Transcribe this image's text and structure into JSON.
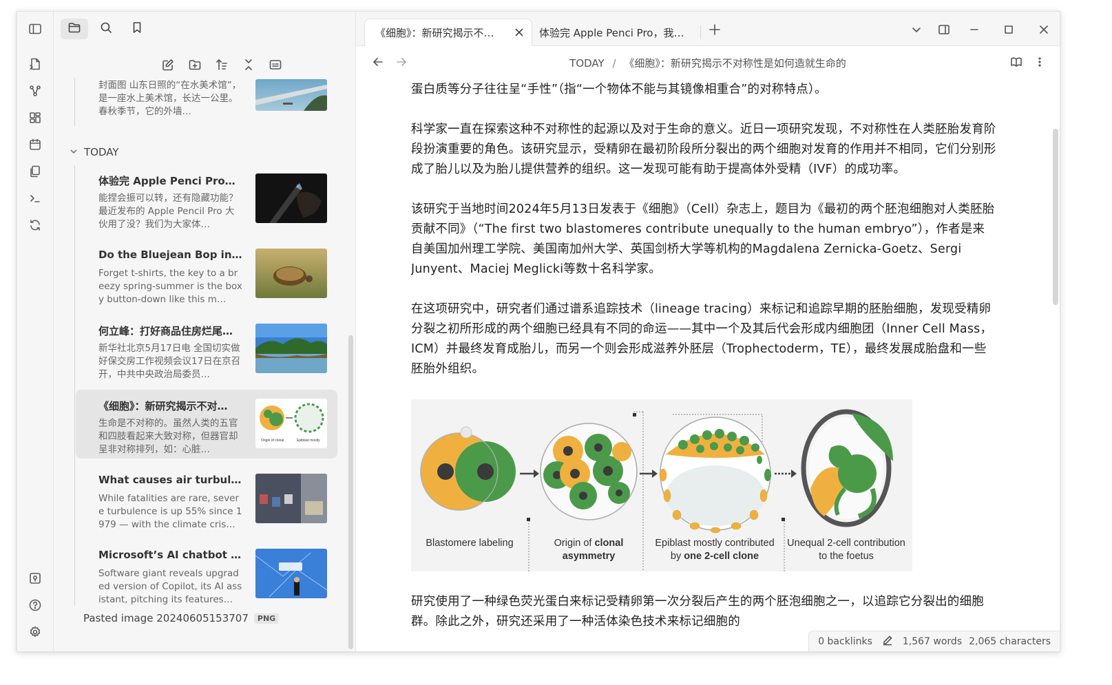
{
  "ribbon": {
    "icons": [
      "open-quick-switcher-icon",
      "graph-view-icon",
      "canvas-icon",
      "daily-note-icon",
      "templates-icon",
      "command-palette-icon",
      "sync-icon",
      "open-vault-icon",
      "help-icon",
      "settings-icon"
    ]
  },
  "sidebar": {
    "tabs": [
      "sidebar-toggle-icon",
      "files-icon",
      "search-icon",
      "bookmarks-icon"
    ],
    "toolbar": [
      "new-note-icon",
      "new-folder-icon",
      "sort-icon",
      "collapse-all-icon",
      "auto-reveal-icon"
    ],
    "top_partial": {
      "snippet": "封面图 山东日照的“在水美术馆”，是一座水上美术馆，长达一公里。春秋季节，它的外墙…"
    },
    "folder": "TODAY",
    "notes": [
      {
        "title": "体验完 Apple Penci Pro，…",
        "snippet": "能捏会振可以转，还有隐藏功能？最近发布的 Apple Pencil Pro 大伙用了没？我们为大家体…",
        "thumb": "pencil"
      },
      {
        "title": "Do the Bluejean Bop in J…",
        "snippet": "Forget t-shirts, the key to a breezy spring-summer is the boxy button-down like this m…",
        "thumb": "tortoise"
      },
      {
        "title": "何立峰：打好商品住房烂尾…",
        "snippet": "新华社北京5月17日电 全国切实做好保交房工作视频会议17日在京召开，中共中央政治局委员…",
        "thumb": "lake"
      },
      {
        "title": "《细胞》：新研究揭示不对…",
        "snippet": "生命是不对称的。虽然人类的五官和四肢看起来大致对称，但器官却呈非对称排列，如：心脏…",
        "thumb": "cells"
      },
      {
        "title": "What causes air turbulen…",
        "snippet": "While fatalities are rare, severe turbulence is up 55% since 1979 — with the climate cris…",
        "thumb": "plane"
      },
      {
        "title": "Microsoft’s AI chatbot wi…",
        "snippet": "Software giant reveals upgraded version of Copilot, its AI assistant, pitching its features…",
        "thumb": "stage"
      }
    ],
    "attachment": {
      "name": "Pasted image 20240605153707",
      "badge": "PNG"
    }
  },
  "tabs": [
    {
      "label": "《细胞》：新研究揭示不…",
      "active": true
    },
    {
      "label": "体验完 Apple Penci Pro，我…",
      "active": false
    }
  ],
  "breadcrumb": {
    "folder": "TODAY",
    "separator": "/",
    "file": "《细胞》：新研究揭示不对称性是如何造就生命的"
  },
  "content": {
    "paragraphs": [
      "蛋白质等分子往往呈“手性”（指“一个物体不能与其镜像相重合”的对称特点）。",
      "科学家一直在探索这种不对称性的起源以及对于生命的意义。近日一项研究发现，不对称性在人类胚胎发育阶段扮演重要的角色。该研究显示，受精卵在最初阶段所分裂出的两个细胞对发育的作用并不相同，它们分别形成了胎儿以及为胎儿提供营养的组织。这一发现可能有助于提高体外受精（IVF）的成功率。",
      "该研究于当地时间2024年5月13日发表于《细胞》（Cell）杂志上，题目为《最初的两个胚泡细胞对人类胚胎贡献不同》（“The first two blastomeres contribute unequally to the human embryo”），作者是来自美国加州理工学院、美国南加州大学、英国剑桥大学等机构的Magdalena Zernicka-Goetz、Sergi Junyent、Maciej Meglicki等数十名科学家。",
      "在这项研究中，研究者们通过谱系追踪技术（lineage tracing）来标记和追踪早期的胚胎细胞，发现受精卵分裂之初所形成的两个细胞已经具有不同的命运——其中一个及其后代会形成内细胞团（Inner Cell Mass，ICM）并最终发育成胎儿，而另一个则会形成滋养外胚层（Trophectoderm，TE），最终发展成胎盘和一些胚胎外组织。"
    ],
    "after_figure": "研究使用了一种绿色荧光蛋白来标记受精卵第一次分裂后产生的两个胚泡细胞之一，以追踪它分裂出的细胞群。除此之外，研究还采用了一种活体染色技术来标记细胞的",
    "figure": {
      "captions": [
        {
          "plain": "Blastomere labeling",
          "bold": ""
        },
        {
          "plain": "Origin of ",
          "bold": "clonal asymmetry"
        },
        {
          "plain": "Epiblast mostly contributed by ",
          "bold": "one 2-cell clone"
        },
        {
          "plain": "Unequal 2-cell contribution to the foetus",
          "bold": ""
        }
      ]
    }
  },
  "status": {
    "backlinks": "0 backlinks",
    "words": "1,567 words",
    "characters": "2,065 characters"
  },
  "colors": {
    "green": "#4a9a4a",
    "orange": "#f0b040",
    "dark_nucleus": "#3a3a3a"
  }
}
